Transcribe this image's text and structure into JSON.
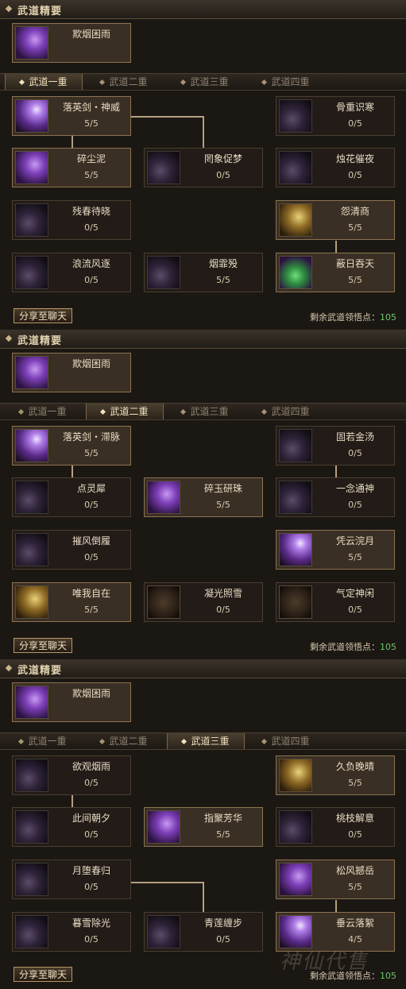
{
  "sections": [
    {
      "title": "武道精要",
      "essence": {
        "name": "欺烟困雨"
      },
      "tabs": [
        "武道一重",
        "武道二重",
        "武道三重",
        "武道四重"
      ],
      "active_tab": 0,
      "nodes": [
        {
          "name": "落英剑・神威",
          "level": "5/5",
          "learned": true,
          "icon": "sword-slash-icon"
        },
        {
          "name": "碎尘泥",
          "level": "5/5",
          "learned": true,
          "icon": "sword-slash-icon"
        },
        {
          "name": "罔象促梦",
          "level": "0/5",
          "learned": false,
          "icon": "sword-slash-icon"
        },
        {
          "name": "残春待晓",
          "level": "0/5",
          "learned": false,
          "icon": "moon-slash-icon"
        },
        {
          "name": "浪流风逐",
          "level": "0/5",
          "learned": false,
          "icon": "swirl-slash-icon"
        },
        {
          "name": "烟霏殁",
          "level": "5/5",
          "learned": false,
          "icon": "sword-slash-icon"
        },
        {
          "name": "骨重识寒",
          "level": "0/5",
          "learned": false,
          "icon": "skull-icon"
        },
        {
          "name": "烛花催夜",
          "level": "0/5",
          "learned": false,
          "icon": "skull-icon"
        },
        {
          "name": "怨清商",
          "level": "5/5",
          "learned": true,
          "icon": "flame-icon"
        },
        {
          "name": "蔽日吞天",
          "level": "5/5",
          "learned": true,
          "icon": "green-wave-icon"
        }
      ],
      "share_label": "分享至聊天",
      "points_label": "剩余武道领悟点：",
      "points_value": "105"
    },
    {
      "title": "武道精要",
      "essence": {
        "name": "欺烟困雨"
      },
      "tabs": [
        "武道一重",
        "武道二重",
        "武道三重",
        "武道四重"
      ],
      "active_tab": 1,
      "nodes": [
        {
          "name": "落英剑・滞脉",
          "level": "5/5",
          "learned": true,
          "icon": "sword-slash-icon"
        },
        {
          "name": "点灵犀",
          "level": "0/5",
          "learned": false,
          "icon": "swirl-slash-icon"
        },
        {
          "name": "碎玉研珠",
          "level": "5/5",
          "learned": true,
          "icon": "sword-slash-icon"
        },
        {
          "name": "摧风倒履",
          "level": "0/5",
          "learned": false,
          "icon": "swirl-slash-icon"
        },
        {
          "name": "唯我自在",
          "level": "5/5",
          "learned": true,
          "icon": "warrior-icon"
        },
        {
          "name": "凝光照雪",
          "level": "0/5",
          "learned": false,
          "icon": "scroll-icon"
        },
        {
          "name": "固若金汤",
          "level": "0/5",
          "learned": false,
          "icon": "skull-icon"
        },
        {
          "name": "一念通神",
          "level": "0/5",
          "learned": false,
          "icon": "swirl-slash-icon"
        },
        {
          "name": "凭云浣月",
          "level": "5/5",
          "learned": true,
          "icon": "moon-slash-icon"
        },
        {
          "name": "气定神闲",
          "level": "0/5",
          "learned": false,
          "icon": "monk-icon"
        }
      ],
      "share_label": "分享至聊天",
      "points_label": "剩余武道领悟点：",
      "points_value": "105"
    },
    {
      "title": "武道精要",
      "essence": {
        "name": "欺烟困雨"
      },
      "tabs": [
        "武道一重",
        "武道二重",
        "武道三重",
        "武道四重"
      ],
      "active_tab": 2,
      "nodes": [
        {
          "name": "欲观烟雨",
          "level": "0/5",
          "learned": false,
          "icon": "swirl-slash-icon"
        },
        {
          "name": "此间朝夕",
          "level": "0/5",
          "learned": false,
          "icon": "moon-slash-icon"
        },
        {
          "name": "指聚芳华",
          "level": "5/5",
          "learned": true,
          "icon": "sword-slash-icon"
        },
        {
          "name": "月堕春归",
          "level": "0/5",
          "learned": false,
          "icon": "moon-slash-icon"
        },
        {
          "name": "暮雪除光",
          "level": "0/5",
          "learned": false,
          "icon": "skull-icon"
        },
        {
          "name": "青莲缠步",
          "level": "0/5",
          "learned": false,
          "icon": "sword-slash-icon"
        },
        {
          "name": "久负晚晴",
          "level": "5/5",
          "learned": true,
          "icon": "moon-warrior-icon"
        },
        {
          "name": "桃枝解意",
          "level": "0/5",
          "learned": false,
          "icon": "moon-slash-icon"
        },
        {
          "name": "松风撼岳",
          "level": "5/5",
          "learned": true,
          "icon": "sword-slash-icon"
        },
        {
          "name": "垂云落絮",
          "level": "4/5",
          "learned": true,
          "icon": "sword-slash-icon"
        }
      ],
      "share_label": "分享至聊天",
      "points_label": "剩余武道领悟点：",
      "points_value": "105"
    }
  ],
  "watermark": "神仙代售",
  "colors": {
    "points_value": "#68c86a",
    "accent_border": "#b49767",
    "panel_bg": "#1b1713"
  }
}
